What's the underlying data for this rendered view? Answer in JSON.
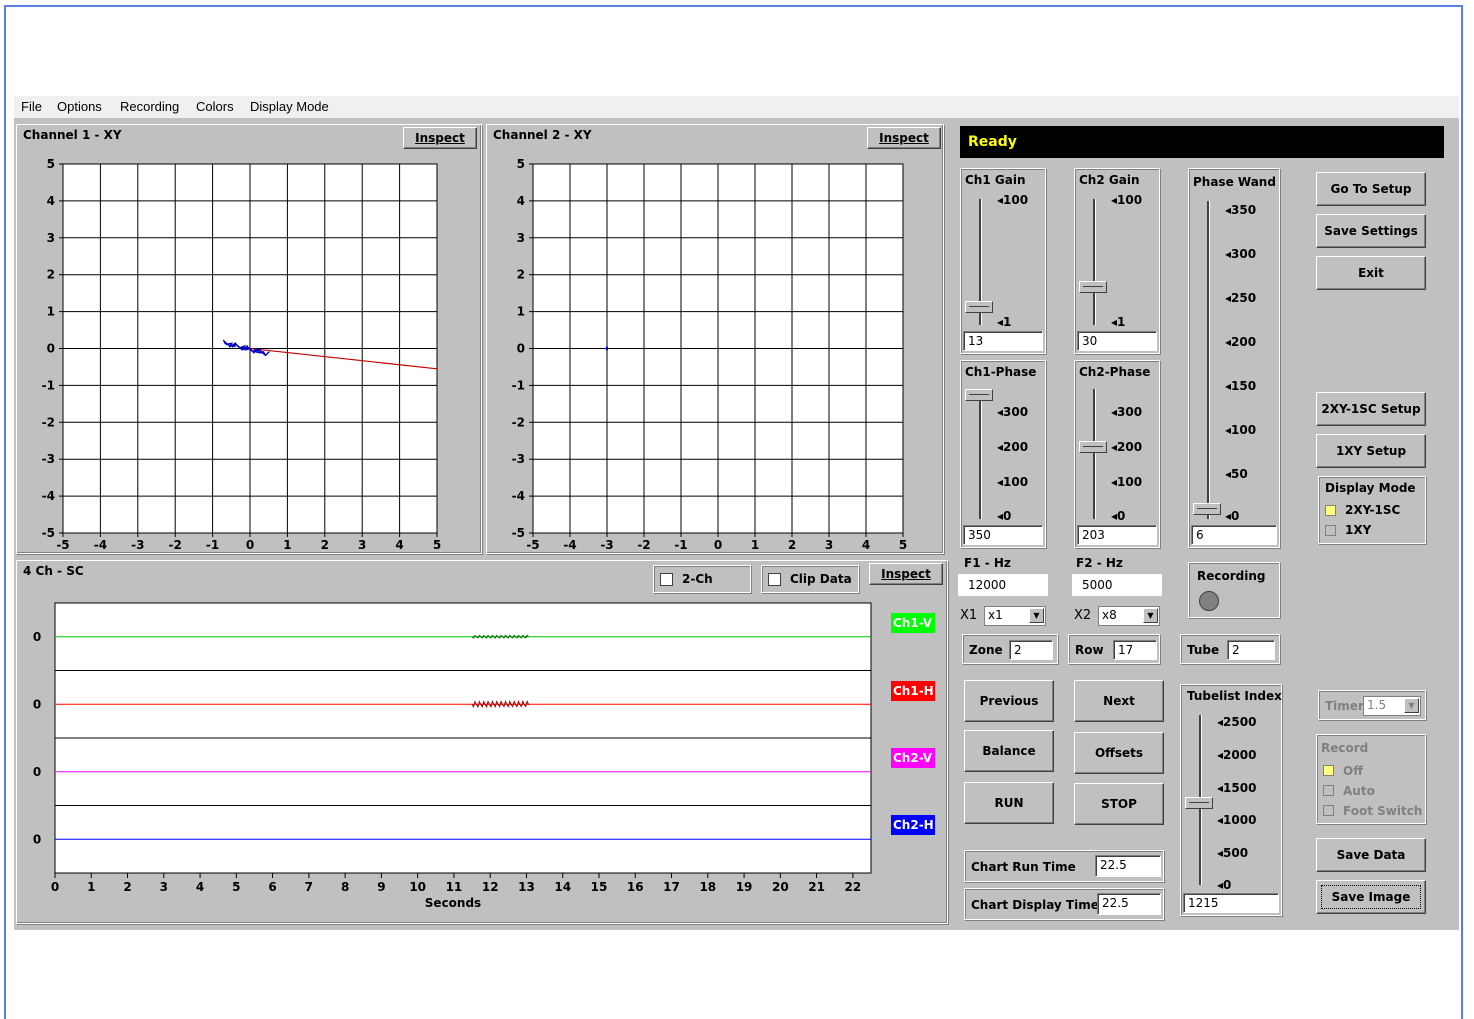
{
  "menu": [
    "File",
    "Options",
    "Recording",
    "Colors",
    "Display Mode"
  ],
  "ch1": {
    "title": "Channel 1 - XY",
    "inspect": "Inspect",
    "xticks": [
      "-5",
      "-4",
      "-3",
      "-2",
      "-1",
      "0",
      "1",
      "2",
      "3",
      "4",
      "5"
    ],
    "yticks": [
      "5",
      "4",
      "3",
      "2",
      "1",
      "0",
      "-1",
      "-2",
      "-3",
      "-4",
      "-5"
    ]
  },
  "ch2": {
    "title": "Channel 2 - XY",
    "inspect": "Inspect",
    "xticks": [
      "-5",
      "-4",
      "-3",
      "-2",
      "-1",
      "0",
      "1",
      "2",
      "3",
      "4",
      "5"
    ],
    "yticks": [
      "5",
      "4",
      "3",
      "2",
      "1",
      "0",
      "-1",
      "-2",
      "-3",
      "-4",
      "-5"
    ]
  },
  "sc": {
    "title": "4 Ch - SC",
    "two_ch": "2-Ch",
    "clip": "Clip Data",
    "inspect": "Inspect",
    "xlabel": "Seconds",
    "xticks": [
      "0",
      "1",
      "2",
      "3",
      "4",
      "5",
      "6",
      "7",
      "8",
      "9",
      "10",
      "11",
      "12",
      "13",
      "14",
      "15",
      "16",
      "17",
      "18",
      "19",
      "20",
      "21",
      "22"
    ],
    "yzero": "0",
    "legend": [
      {
        "label": "Ch1-V",
        "color": "#00ff00"
      },
      {
        "label": "Ch1-H",
        "color": "#ff0000"
      },
      {
        "label": "Ch2-V",
        "color": "#ff00ff"
      },
      {
        "label": "Ch2-H",
        "color": "#0000ff"
      }
    ]
  },
  "status": "Ready",
  "ch1_gain": {
    "title": "Ch1 Gain",
    "max": "100",
    "min": "1",
    "value": "13"
  },
  "ch2_gain": {
    "title": "Ch2 Gain",
    "max": "100",
    "min": "1",
    "value": "30"
  },
  "ch1_phase": {
    "title": "Ch1-Phase",
    "ticks": [
      "300",
      "200",
      "100",
      "0"
    ],
    "value": "350"
  },
  "ch2_phase": {
    "title": "Ch2-Phase",
    "ticks": [
      "300",
      "200",
      "100",
      "0"
    ],
    "value": "203"
  },
  "phase_wand": {
    "title": "Phase Wand",
    "ticks": [
      "350",
      "300",
      "250",
      "200",
      "150",
      "100",
      "50",
      "0"
    ],
    "value": "6"
  },
  "f1": {
    "label": "F1 - Hz",
    "value": "12000",
    "mult_label": "X1",
    "mult": "x1"
  },
  "f2": {
    "label": "F2 - Hz",
    "value": "5000",
    "mult_label": "X2",
    "mult": "x8"
  },
  "recording_label": "Recording",
  "zone": {
    "label": "Zone",
    "value": "2"
  },
  "row": {
    "label": "Row",
    "value": "17"
  },
  "tube": {
    "label": "Tube",
    "value": "2"
  },
  "buttons": {
    "previous": "Previous",
    "next": "Next",
    "balance": "Balance",
    "offsets": "Offsets",
    "run": "RUN",
    "stop": "STOP",
    "go_setup": "Go To Setup",
    "save_settings": "Save Settings",
    "exit": "Exit",
    "setup_2xy": "2XY-1SC Setup",
    "setup_1xy": "1XY Setup",
    "save_data": "Save Data",
    "save_image": "Save Image"
  },
  "chart_run": {
    "label": "Chart Run Time",
    "value": "22.5"
  },
  "chart_display": {
    "label": "Chart Display Time",
    "value": "22.5"
  },
  "tubelist": {
    "title": "Tubelist Index",
    "ticks": [
      "2500",
      "2000",
      "1500",
      "1000",
      "500",
      "0"
    ],
    "value": "1215"
  },
  "display_mode": {
    "title": "Display Mode",
    "options": [
      "2XY-1SC",
      "1XY"
    ],
    "selected": "2XY-1SC"
  },
  "timer": {
    "label": "Timer",
    "value": "1.5"
  },
  "record": {
    "title": "Record",
    "options": [
      "Off",
      "Auto",
      "Foot Switch"
    ],
    "selected": "Off"
  }
}
